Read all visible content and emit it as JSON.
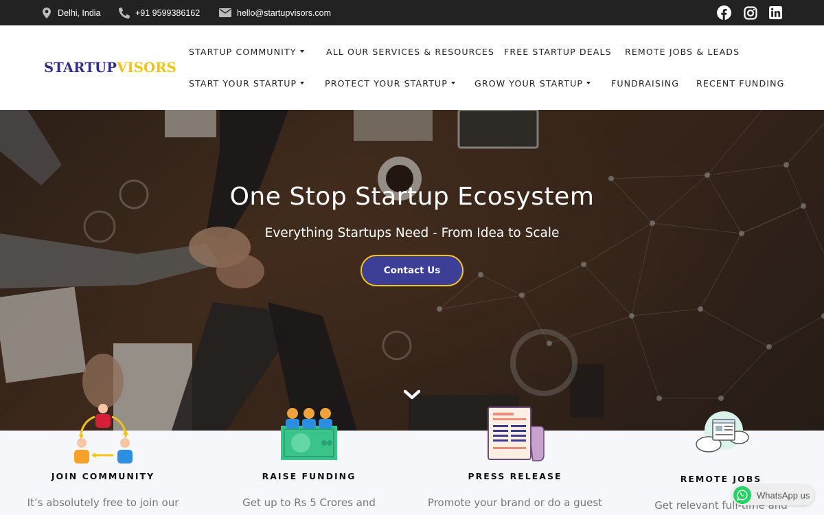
{
  "topbar": {
    "location": "Delhi, India",
    "phone": "+91 9599386162",
    "email": "hello@startupvisors.com",
    "social": [
      "facebook-icon",
      "instagram-icon",
      "linkedin-icon"
    ]
  },
  "logo": {
    "part1": "STARTUP",
    "part2": "VISORS"
  },
  "nav": {
    "row1": [
      "STARTUP COMMUNITY",
      "ALL OUR SERVICES & RESOURCES",
      "FREE STARTUP DEALS",
      "REMOTE JOBS & LEADS"
    ],
    "row2": [
      "START YOUR STARTUP",
      "PROTECT YOUR STARTUP",
      "GROW YOUR STARTUP",
      "FUNDRAISING",
      "RECENT FUNDING"
    ]
  },
  "hero": {
    "title": "One Stop Startup Ecosystem",
    "subtitle": "Everything Startups Need - From Idea to Scale",
    "cta": "Contact Us"
  },
  "features": [
    {
      "title": "JOIN COMMUNITY",
      "desc": "It’s absolutely free to join our",
      "icon": "community-icon"
    },
    {
      "title": "RAISE FUNDING",
      "desc": "Get up to Rs 5 Crores and",
      "icon": "funding-icon"
    },
    {
      "title": "PRESS RELEASE",
      "desc": "Promote your brand or do a guest",
      "icon": "newspaper-icon"
    },
    {
      "title": "REMOTE JOBS",
      "desc": "Get relevant full-time and",
      "icon": "cloud-jobs-icon"
    }
  ],
  "whatsapp": {
    "label": "WhatsApp us"
  },
  "colors": {
    "brand_dark": "#2e2f87",
    "brand_yellow": "#f2c418",
    "cta_bg": "#3d3e96",
    "topbar": "#222222"
  }
}
